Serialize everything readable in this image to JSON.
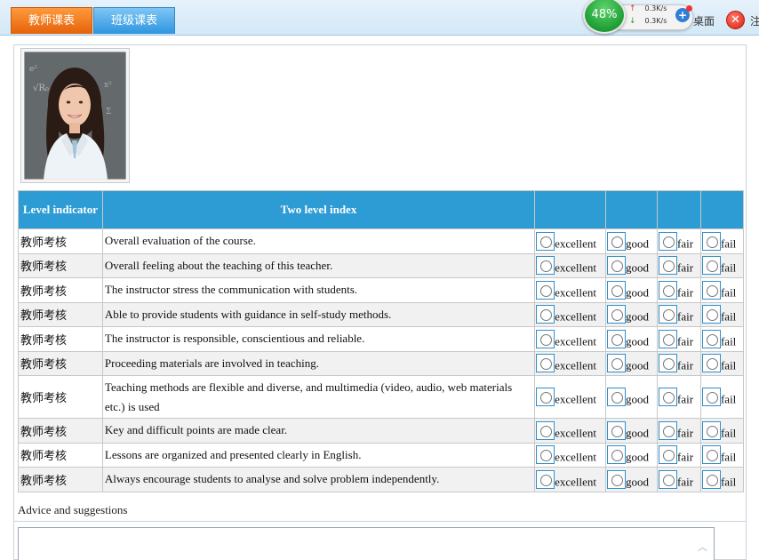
{
  "tabs": [
    {
      "label": "教师课表",
      "active": true
    },
    {
      "label": "班级课表",
      "active": false
    }
  ],
  "monitor": {
    "percent": "48%",
    "upload": "0.3K/s",
    "download": "0.3K/s"
  },
  "desktop_label": "桌面",
  "trailing_label": "注",
  "table": {
    "headers": {
      "level": "Level indicator",
      "index": "Two level index"
    },
    "options": [
      "excellent",
      "good",
      "fair",
      "fail"
    ],
    "rows": [
      {
        "category": "教师考核",
        "question": "Overall evaluation of the course."
      },
      {
        "category": "教师考核",
        "question": "Overall feeling about the teaching of this teacher."
      },
      {
        "category": "教师考核",
        "question": "The instructor stress the communication with students."
      },
      {
        "category": "教师考核",
        "question": "Able to provide students with guidance in self-study methods."
      },
      {
        "category": "教师考核",
        "question": "The instructor is responsible, conscientious and reliable."
      },
      {
        "category": "教师考核",
        "question": "Proceeding materials are involved in teaching."
      },
      {
        "category": "教师考核",
        "question": "Teaching methods are flexible and diverse, and multimedia (video, audio, web materials etc.) is used"
      },
      {
        "category": "教师考核",
        "question": "Key and difficult points are made clear."
      },
      {
        "category": "教师考核",
        "question": "Lessons are organized and presented clearly in English."
      },
      {
        "category": "教师考核",
        "question": "Always encourage students to analyse and solve problem independently."
      }
    ]
  },
  "advice": {
    "label": "Advice and suggestions",
    "value": ""
  },
  "colors": {
    "header_blue": "#2d9bd4",
    "tab_orange": "#e5620a",
    "tab_blue": "#2e95e0"
  }
}
